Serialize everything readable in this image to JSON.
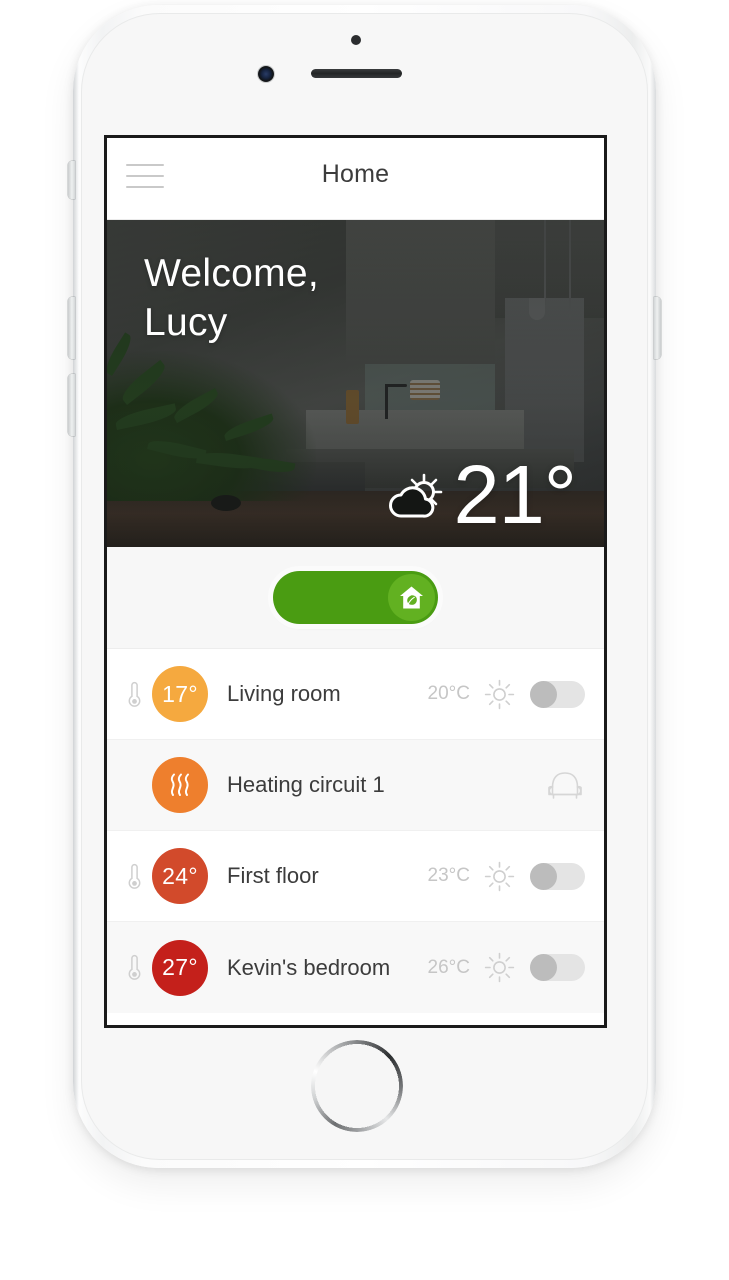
{
  "device": {
    "name": "white-smartphone",
    "hardware": [
      "sensor",
      "front-camera",
      "earpiece-speaker",
      "silent-switch",
      "volume-up",
      "volume-down",
      "power-button",
      "home-button"
    ]
  },
  "app": {
    "topbar": {
      "menu_icon": "hamburger-menu-icon",
      "title": "Home"
    },
    "hero": {
      "greeting_line1": "Welcome,",
      "greeting_line2": "Lucy",
      "weather_icon": "partly-cloudy-icon",
      "temperature": "21°",
      "background": "kitchen-photo"
    },
    "eco_toggle": {
      "state": "on",
      "icon": "eco-house-leaf-icon",
      "track_color": "#4a9c12",
      "knob_color": "#62b121"
    },
    "rooms": [
      {
        "thermometer_icon": "thermometer-icon",
        "bubble_value": "17°",
        "bubble_color": "#f5a93f",
        "bubble_icon": "",
        "name": "Living room",
        "target_temp": "20°C",
        "mode_icon": "sun-icon",
        "toggle": "off",
        "alt_row": false
      },
      {
        "thermometer_icon": "",
        "bubble_value": "",
        "bubble_color": "#ee7f2d",
        "bubble_icon": "heat-waves-icon",
        "name": "Heating circuit 1",
        "target_temp": "",
        "mode_icon": "armchair-icon",
        "toggle": "none",
        "alt_row": true
      },
      {
        "thermometer_icon": "thermometer-icon",
        "bubble_value": "24°",
        "bubble_color": "#d24a2b",
        "bubble_icon": "",
        "name": "First floor",
        "target_temp": "23°C",
        "mode_icon": "sun-icon",
        "toggle": "off",
        "alt_row": false
      },
      {
        "thermometer_icon": "thermometer-icon",
        "bubble_value": "27°",
        "bubble_color": "#c4201b",
        "bubble_icon": "",
        "name": "Kevin's bedroom",
        "target_temp": "26°C",
        "mode_icon": "sun-icon",
        "toggle": "off",
        "alt_row": true
      }
    ]
  }
}
